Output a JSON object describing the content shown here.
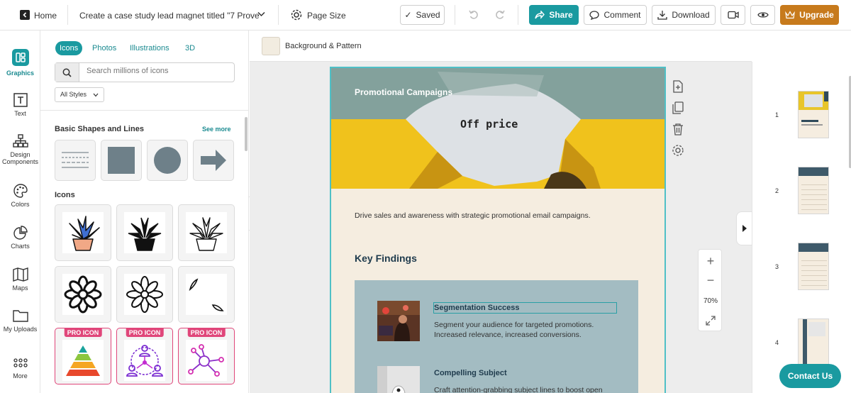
{
  "topbar": {
    "home_label": "Home",
    "doc_title": "Create a case study lead magnet titled \"7 Prove",
    "page_size_label": "Page Size",
    "saved_label": "Saved",
    "share_label": "Share",
    "comment_label": "Comment",
    "download_label": "Download",
    "upgrade_label": "Upgrade"
  },
  "rail": {
    "items": [
      {
        "label": "Graphics"
      },
      {
        "label": "Text"
      },
      {
        "label": "Design Components"
      },
      {
        "label": "Colors"
      },
      {
        "label": "Charts"
      },
      {
        "label": "Maps"
      },
      {
        "label": "My Uploads"
      },
      {
        "label": "More"
      }
    ]
  },
  "panel": {
    "tabs": [
      "Icons",
      "Photos",
      "Illustrations",
      "3D"
    ],
    "search_placeholder": "Search millions of icons",
    "style_filter": "All Styles",
    "shapes_title": "Basic Shapes and Lines",
    "see_more": "See more",
    "icons_title": "Icons",
    "pro_badge": "PRO ICON"
  },
  "subbar": {
    "background_label": "Background & Pattern"
  },
  "page": {
    "banner_title": "Promotional Campaigns",
    "paper_text": "Off price",
    "intro": "Drive sales and awareness with strategic promotional email campaigns.",
    "key_findings": "Key Findings",
    "finding1_title": "Segmentation Success",
    "finding1_body1": "Segment your audience for targeted promotions.",
    "finding1_body2": "Increased relevance, increased conversions.",
    "finding2_title": "Compelling Subject",
    "finding2_body": "Craft attention-grabbing subject lines to boost open"
  },
  "zoom": {
    "level": "70%"
  },
  "thumbs": {
    "numbers": [
      "1",
      "2",
      "3",
      "4"
    ]
  },
  "contact_label": "Contact Us",
  "colors": {
    "accent": "#1a9aa0",
    "upgrade": "#c77a1c",
    "pro": "#e0467a",
    "page_bg": "#f5ede0",
    "findings_bg": "#a3bcc2"
  }
}
